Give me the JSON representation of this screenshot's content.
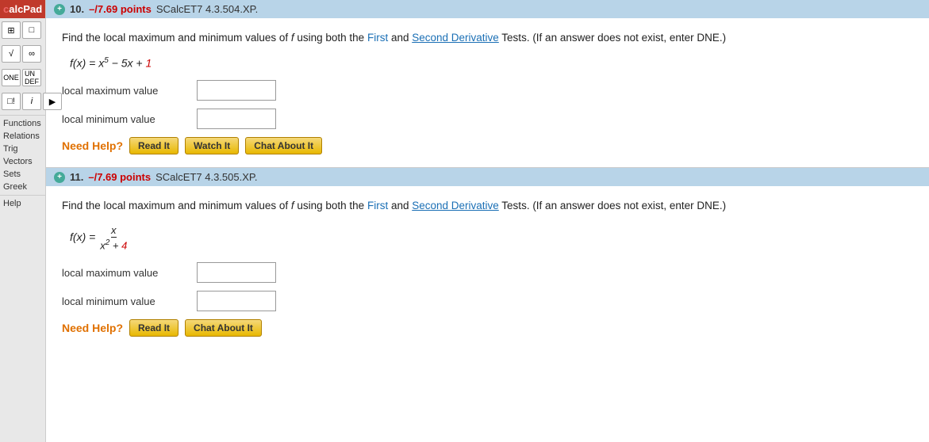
{
  "sidebar": {
    "calcpad_label": "calcPad",
    "icons": [
      {
        "name": "matrix-icon",
        "symbol": "⊞"
      },
      {
        "name": "template-icon",
        "symbol": "□"
      },
      {
        "name": "sqrt-icon",
        "symbol": "√"
      },
      {
        "name": "infinity-icon",
        "symbol": "∞"
      },
      {
        "name": "one-icon",
        "symbol": "1"
      },
      {
        "name": "undef-icon",
        "symbol": "UN"
      },
      {
        "name": "excl-icon",
        "symbol": "□!"
      },
      {
        "name": "imag-icon",
        "symbol": "i"
      },
      {
        "name": "arrow-icon",
        "symbol": "▶"
      }
    ],
    "nav_items": [
      {
        "label": "Functions"
      },
      {
        "label": "Relations"
      },
      {
        "label": "Trig"
      },
      {
        "label": "Vectors"
      },
      {
        "label": "Sets"
      },
      {
        "label": "Greek"
      },
      {
        "label": "Help"
      }
    ]
  },
  "question10": {
    "number": "10.",
    "points": "–/7.69 points",
    "code": "SCalcET7 4.3.504.XP.",
    "question_text": "Find the local maximum and minimum values of f using both the First and Second Derivative Tests. (If an answer does not exist, enter DNE.)",
    "formula": "f(x) = x⁵ − 5x + 1",
    "local_max_label": "local maximum value",
    "local_min_label": "local minimum value",
    "need_help_label": "Need Help?",
    "btn_read": "Read It",
    "btn_watch": "Watch It",
    "btn_chat": "Chat About It"
  },
  "question11": {
    "number": "11.",
    "points": "–/7.69 points",
    "code": "SCalcET7 4.3.505.XP.",
    "question_text": "Find the local maximum and minimum values of f using both the First and Second Derivative Tests. (If an answer does not exist, enter DNE.)",
    "formula_prefix": "f(x) =",
    "formula_num": "x",
    "formula_denom": "x² + 4",
    "local_max_label": "local maximum value",
    "local_min_label": "local minimum value",
    "need_help_label": "Need Help?",
    "btn_read": "Read It",
    "btn_chat": "Chat About It"
  },
  "colors": {
    "accent_orange": "#e07000",
    "link_blue": "#1a6fb5",
    "header_bg": "#b8d4e8",
    "red": "#c00000",
    "green_dot": "#4a9"
  }
}
